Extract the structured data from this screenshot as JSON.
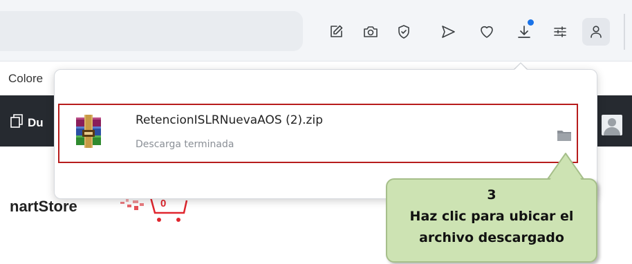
{
  "toolbar": {
    "icons": [
      "edit-icon",
      "screenshot-icon",
      "shield-icon",
      "send-icon",
      "heart-icon",
      "download-icon",
      "tune-icon",
      "profile-icon"
    ],
    "accent_color": "#1a73e8"
  },
  "page": {
    "colors_label": "Colore",
    "nav_label": "Du",
    "store_name": "nartStore",
    "cart_count": "0"
  },
  "download": {
    "file_name": "RetencionISLRNuevaAOS (2).zip",
    "status": "Descarga terminada",
    "highlight_color": "#b71c1c"
  },
  "callout": {
    "step": "3",
    "line1": "Haz clic para ubicar el",
    "line2": "archivo descargado",
    "fill_color": "#cde3b3"
  }
}
